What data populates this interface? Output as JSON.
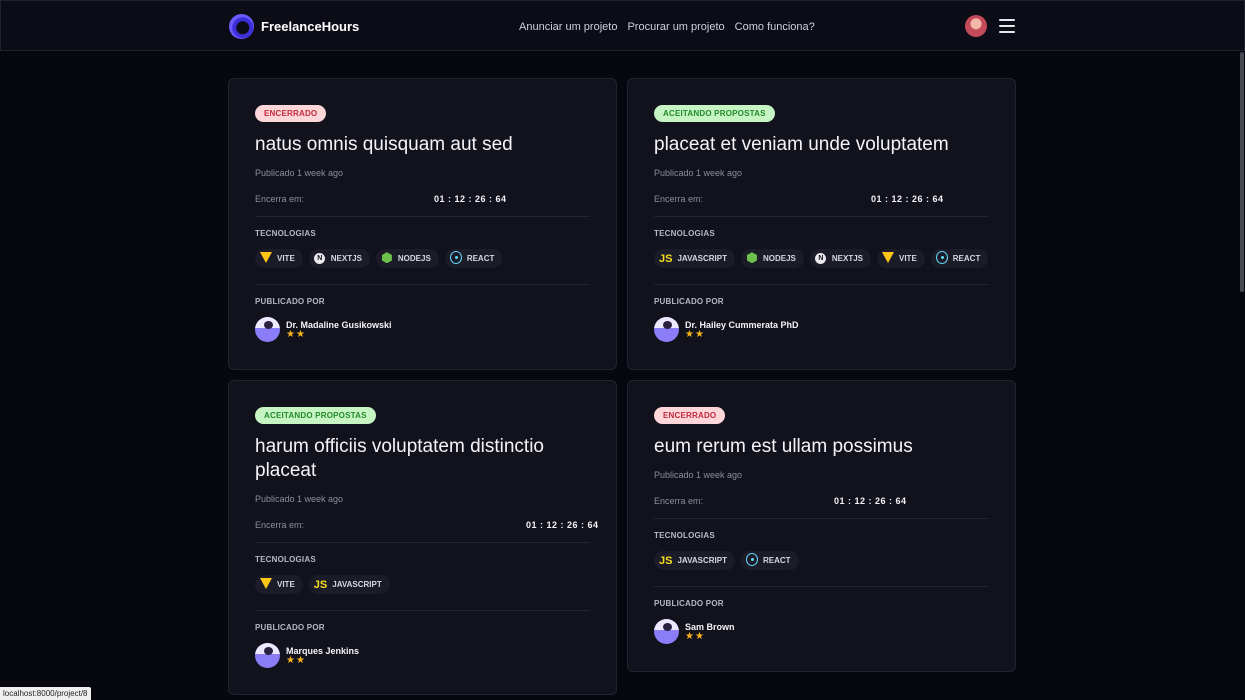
{
  "nav": {
    "brand": "FreelanceHours",
    "links": [
      "Anunciar um projeto",
      "Procurar um projeto",
      "Como funciona?"
    ]
  },
  "labels": {
    "ends": "Encerra em:",
    "technologies": "TECNOLOGIAS",
    "published_by": "PUBLICADO POR"
  },
  "projects": [
    {
      "status": "ENCERRADO",
      "title": "natus omnis quisquam aut sed",
      "published": "Publicado 1 week ago",
      "countdown": "01 : 12 : 26 : 64",
      "techs": [
        {
          "icon": "vite-icon",
          "name": "VITE"
        },
        {
          "icon": "nextjs-icon",
          "name": "NEXTJS"
        },
        {
          "icon": "nodejs-icon",
          "name": "NODEJS"
        },
        {
          "icon": "react-icon",
          "name": "REACT"
        }
      ],
      "author": "Dr. Madaline Gusikowski",
      "stars": "★★"
    },
    {
      "status": "ACEITANDO PROPOSTAS",
      "title": "placeat et veniam unde voluptatem",
      "published": "Publicado 1 week ago",
      "countdown": "01 : 12 : 26 : 64",
      "techs": [
        {
          "icon": "javascript-icon",
          "name": "JAVASCRIPT"
        },
        {
          "icon": "nodejs-icon",
          "name": "NODEJS"
        },
        {
          "icon": "nextjs-icon",
          "name": "NEXTJS"
        },
        {
          "icon": "vite-icon",
          "name": "VITE"
        },
        {
          "icon": "react-icon",
          "name": "REACT"
        }
      ],
      "author": "Dr. Hailey Cummerata PhD",
      "stars": "★★"
    },
    {
      "status": "ACEITANDO PROPOSTAS",
      "title": "harum officiis voluptatem distinctio placeat",
      "published": "Publicado 1 week ago",
      "countdown": "01 : 12 : 26 : 64",
      "techs": [
        {
          "icon": "vite-icon",
          "name": "VITE"
        },
        {
          "icon": "javascript-icon",
          "name": "JAVASCRIPT"
        }
      ],
      "author": "Marques Jenkins",
      "stars": "★★"
    },
    {
      "status": "ENCERRADO",
      "title": "eum rerum est ullam possimus",
      "published": "Publicado 1 week ago",
      "countdown": "01 : 12 : 26 : 64",
      "techs": [
        {
          "icon": "javascript-icon",
          "name": "JAVASCRIPT"
        },
        {
          "icon": "react-icon",
          "name": "REACT"
        }
      ],
      "author": "Sam Brown",
      "stars": "★★"
    }
  ],
  "status_bar": "localhost:8000/project/8",
  "colors": {
    "background": "#07070f",
    "card": "#12121d",
    "badge_closed_bg": "#fcd6d9",
    "badge_closed_text": "#c22a3c",
    "badge_open_bg": "#c6f5c3",
    "badge_open_text": "#238a2b",
    "star": "#f6b21c"
  }
}
